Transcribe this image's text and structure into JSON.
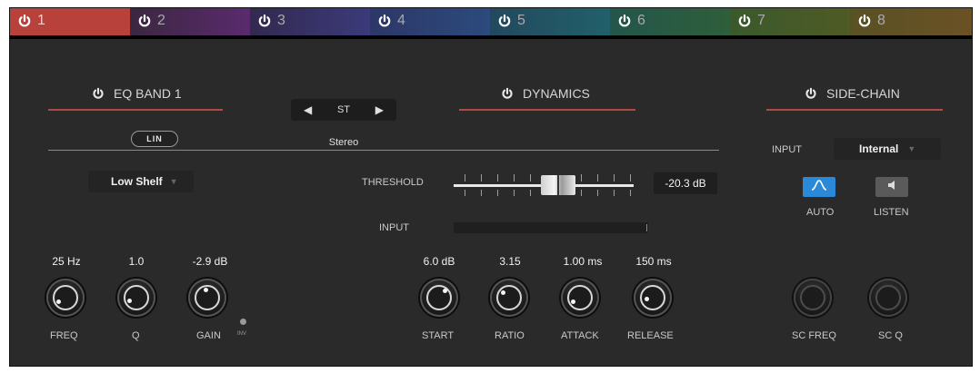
{
  "tabs": [
    {
      "num": "1",
      "active": true,
      "color": "#b9413b"
    },
    {
      "num": "2",
      "color": "#5a2a6e"
    },
    {
      "num": "3",
      "color": "#3b3a7a"
    },
    {
      "num": "4",
      "color": "#2c4a7c"
    },
    {
      "num": "5",
      "color": "#21606a"
    },
    {
      "num": "6",
      "color": "#2e5e3a"
    },
    {
      "num": "7",
      "color": "#4f5a24"
    },
    {
      "num": "8",
      "color": "#6a5124"
    }
  ],
  "eq": {
    "title": "EQ BAND 1",
    "lin_label": "LIN",
    "type_value": "Low Shelf",
    "freq": {
      "value": "25 Hz",
      "label": "FREQ"
    },
    "q": {
      "value": "1.0",
      "label": "Q"
    },
    "gain": {
      "value": "-2.9 dB",
      "label": "GAIN"
    },
    "inv_label": "INV"
  },
  "channel": {
    "mode": "ST",
    "stereo_label": "Stereo",
    "left_icon": "arrow-left-icon",
    "right_icon": "arrow-right-icon"
  },
  "dynamics": {
    "title": "DYNAMICS",
    "threshold_label": "THRESHOLD",
    "threshold_value": "-20.3 dB",
    "input_label": "INPUT",
    "start": {
      "value": "6.0 dB",
      "label": "START"
    },
    "ratio": {
      "value": "3.15",
      "label": "RATIO"
    },
    "attack": {
      "value": "1.00 ms",
      "label": "ATTACK"
    },
    "release": {
      "value": "150 ms",
      "label": "RELEASE"
    }
  },
  "sidechain": {
    "title": "SIDE-CHAIN",
    "input_label": "INPUT",
    "input_value": "Internal",
    "auto_label": "AUTO",
    "listen_label": "LISTEN",
    "sc_freq_label": "SC FREQ",
    "sc_q_label": "SC Q"
  },
  "colors": {
    "accent_line": "#b04a45",
    "auto_active": "#2a8ad8",
    "panel_bg": "#2a2a2a"
  }
}
